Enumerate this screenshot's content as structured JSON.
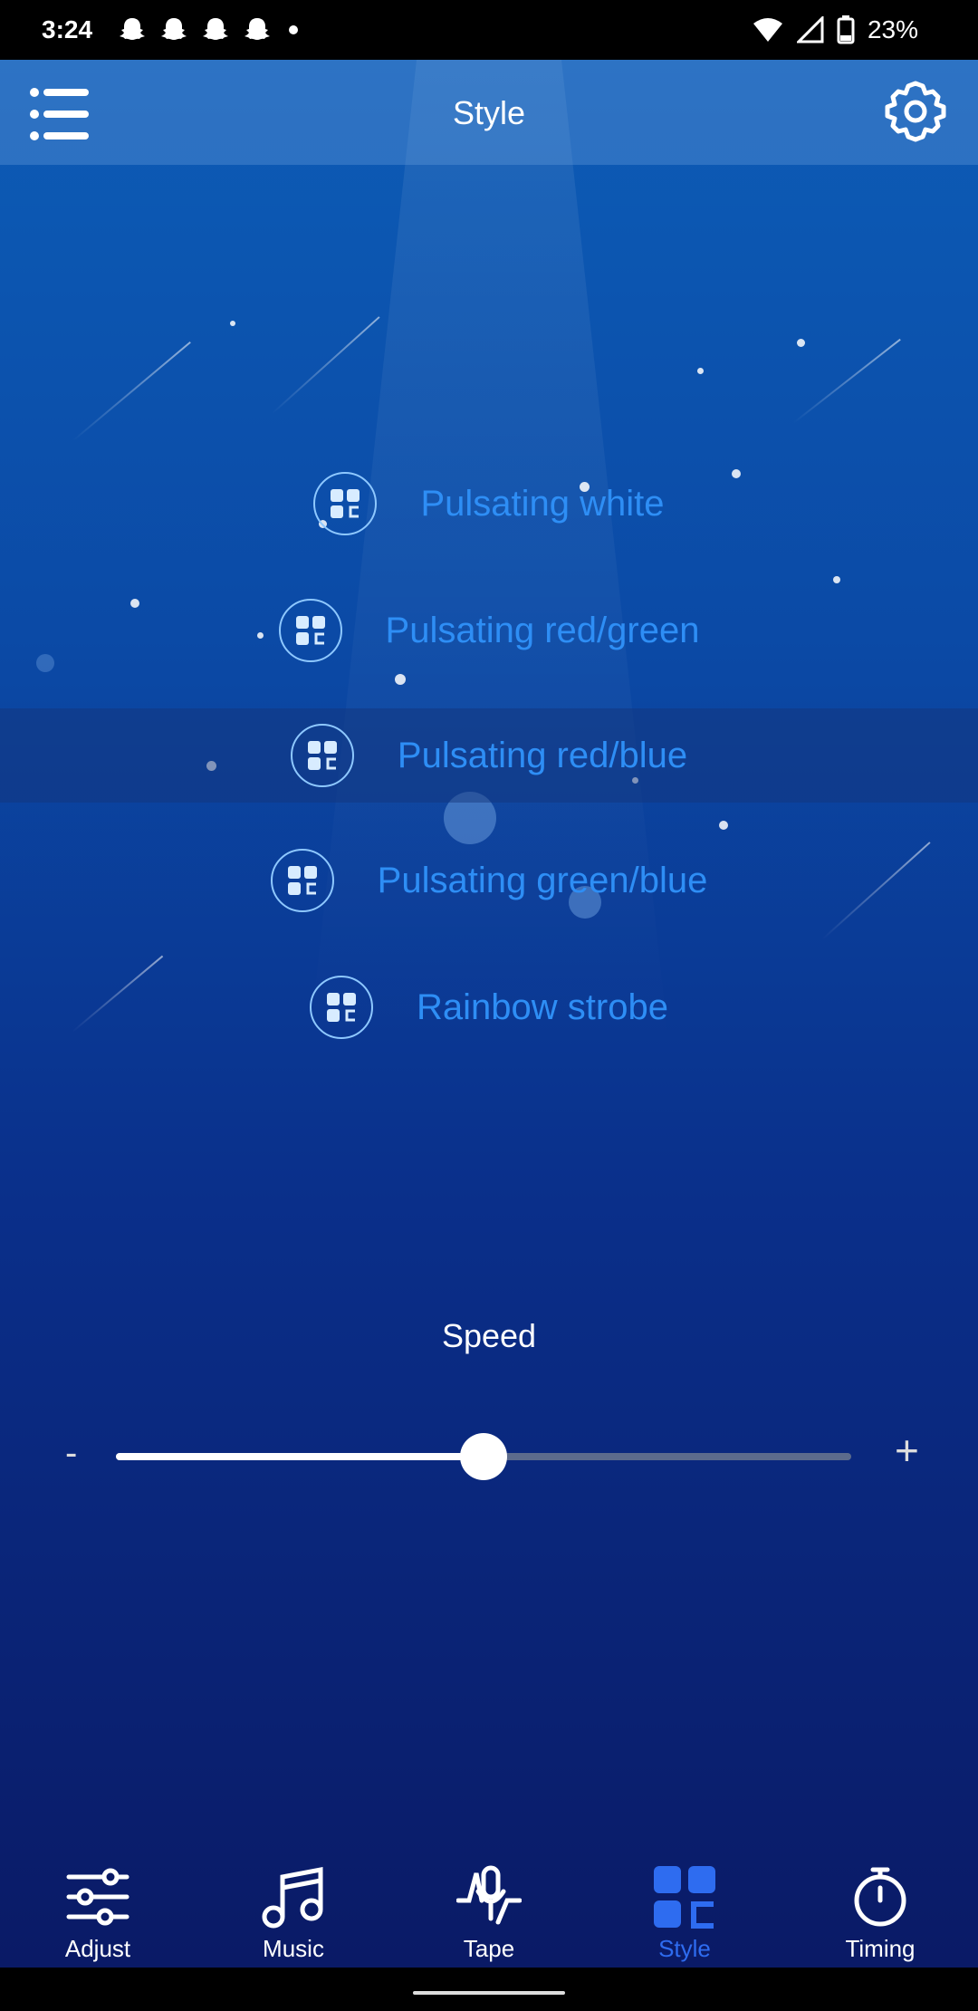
{
  "status": {
    "time": "3:24",
    "battery": "23%",
    "icons": [
      "snapchat-icon",
      "snapchat-icon",
      "snapchat-icon",
      "snapchat-icon",
      "dot-icon",
      "wifi-icon",
      "signal-icon",
      "battery-icon"
    ]
  },
  "header": {
    "title": "Style",
    "menu_icon": "list-icon",
    "settings_icon": "gear-icon"
  },
  "styles": [
    {
      "label": "Pulsating white"
    },
    {
      "label": "Pulsating red/green"
    },
    {
      "label": "Pulsating red/blue",
      "selected": true
    },
    {
      "label": "Pulsating green/blue"
    },
    {
      "label": "Rainbow strobe"
    }
  ],
  "speed": {
    "title": "Speed",
    "minus": "-",
    "plus": "+",
    "value": 0.5
  },
  "nav": [
    {
      "label": "Adjust",
      "icon": "sliders-icon"
    },
    {
      "label": "Music",
      "icon": "music-note-icon"
    },
    {
      "label": "Tape",
      "icon": "microphone-icon"
    },
    {
      "label": "Style",
      "icon": "style-grid-icon",
      "active": true
    },
    {
      "label": "Timing",
      "icon": "timer-icon"
    }
  ],
  "colors": {
    "accent": "#2e8ef5",
    "active_nav": "#2e6cf0"
  }
}
